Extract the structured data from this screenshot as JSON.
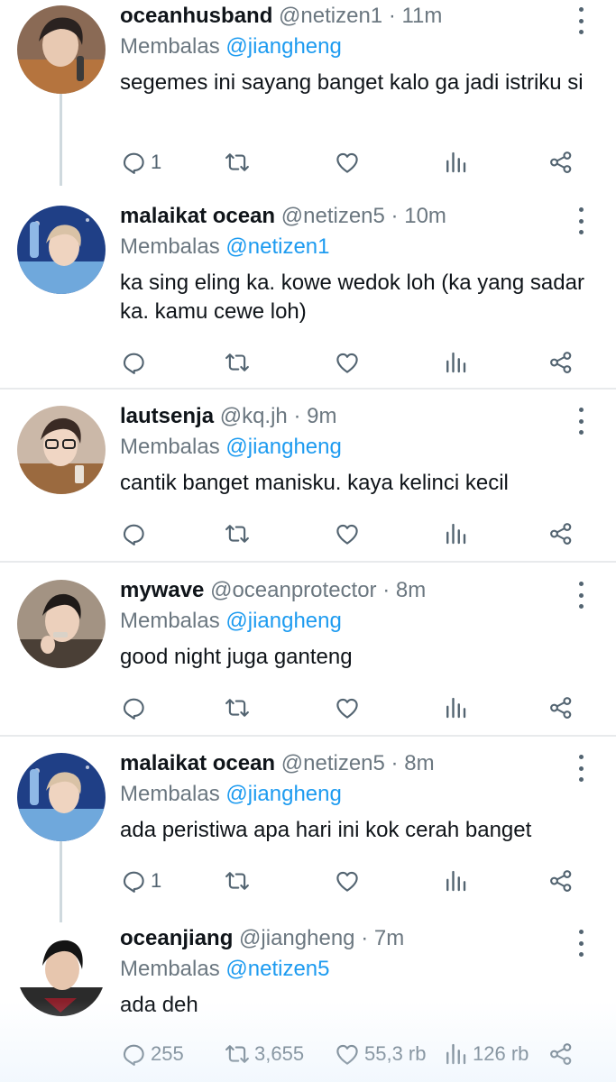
{
  "reply_prefix": "Membalas",
  "icons": {
    "reply": "speech-bubble-icon",
    "retweet": "retweet-icon",
    "like": "heart-icon",
    "views": "bar-chart-icon",
    "share": "share-icon",
    "more": "vertical-dots-icon"
  },
  "colors": {
    "mention": "#1d9bf0",
    "muted": "#6b7780",
    "text": "#0f1419"
  },
  "tweets": [
    {
      "name": "oceanhusband",
      "handle": "@netizen1",
      "dot": "·",
      "time": "11m",
      "reply_to": "@jiangheng",
      "body": "segemes ini sayang banget kalo ga jadi istriku si",
      "reply_count": "1",
      "retweet_count": "",
      "like_count": "",
      "view_count": ""
    },
    {
      "name": "malaikat ocean",
      "handle": "@netizen5",
      "dot": "·",
      "time": "10m",
      "reply_to": "@netizen1",
      "body": "ka sing eling ka. kowe wedok loh (ka yang sadar ka. kamu cewe loh)",
      "reply_count": "",
      "retweet_count": "",
      "like_count": "",
      "view_count": ""
    },
    {
      "name": "lautsenja",
      "handle": "@kq.jh",
      "dot": "·",
      "time": "9m",
      "reply_to": "@jiangheng",
      "body": "cantik banget manisku. kaya kelinci kecil",
      "reply_count": "",
      "retweet_count": "",
      "like_count": "",
      "view_count": ""
    },
    {
      "name": "mywave",
      "handle": "@oceanprotector",
      "dot": "·",
      "time": "8m",
      "reply_to": "@jiangheng",
      "body": "good night juga ganteng",
      "reply_count": "",
      "retweet_count": "",
      "like_count": "",
      "view_count": ""
    },
    {
      "name": "malaikat ocean",
      "handle": "@netizen5",
      "dot": "·",
      "time": "8m",
      "reply_to": "@jiangheng",
      "body": "ada peristiwa apa hari ini kok cerah banget",
      "reply_count": "1",
      "retweet_count": "",
      "like_count": "",
      "view_count": ""
    },
    {
      "name": "oceanjiang",
      "handle": "@jiangheng",
      "dot": "·",
      "time": "7m",
      "reply_to": "@netizen5",
      "body": "ada deh",
      "reply_count": "255",
      "retweet_count": "3,655",
      "like_count": "55,3 rb",
      "view_count": "126 rb"
    }
  ]
}
